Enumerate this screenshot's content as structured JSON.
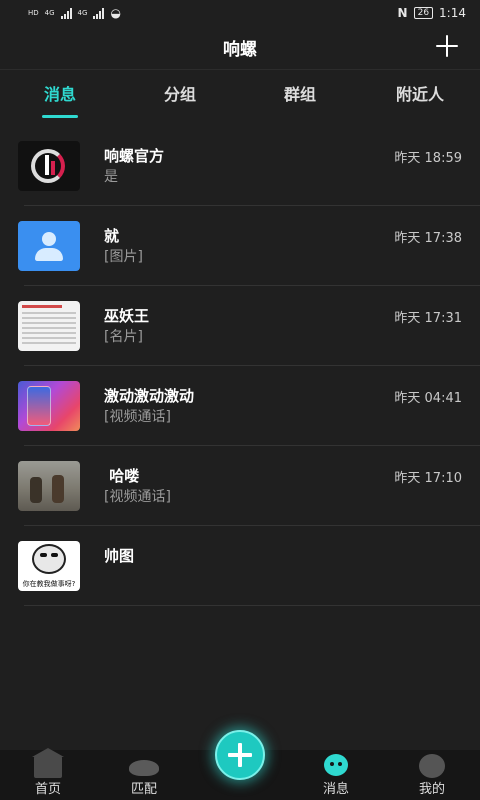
{
  "status": {
    "left_badges": [
      "HD",
      "4G",
      "4G"
    ],
    "nfc": "N",
    "battery": "26",
    "time": "1:14"
  },
  "header": {
    "title": "响螺",
    "add_icon": "plus-icon"
  },
  "tabs": [
    {
      "label": "消息",
      "active": true
    },
    {
      "label": "分组",
      "active": false
    },
    {
      "label": "群组",
      "active": false
    },
    {
      "label": "附近人",
      "active": false
    }
  ],
  "conversations": [
    {
      "name": "响螺官方",
      "message": "是",
      "time": "昨天 18:59"
    },
    {
      "name": "就",
      "message": "[图片]",
      "time": "昨天 17:38"
    },
    {
      "name": "巫妖王",
      "message": "[名片]",
      "time": "昨天 17:31"
    },
    {
      "name": "激动激动激动",
      "message": "[视频通话]",
      "time": "昨天 04:41"
    },
    {
      "name": " 哈喽",
      "message": "[视频通话]",
      "time": "昨天 17:10"
    },
    {
      "name": "帅图",
      "message": "",
      "time": ""
    }
  ],
  "meme_caption": "你在教我做事呀?",
  "bottom_nav": [
    {
      "label": "首页",
      "icon": "home-icon"
    },
    {
      "label": "匹配",
      "icon": "match-icon"
    },
    {
      "label": "",
      "icon": "plus-fab-icon"
    },
    {
      "label": "消息",
      "icon": "message-icon"
    },
    {
      "label": "我的",
      "icon": "profile-icon"
    }
  ],
  "colors": {
    "accent": "#2fd9d0",
    "background": "#1f1f1f",
    "nav_background": "#161616"
  }
}
